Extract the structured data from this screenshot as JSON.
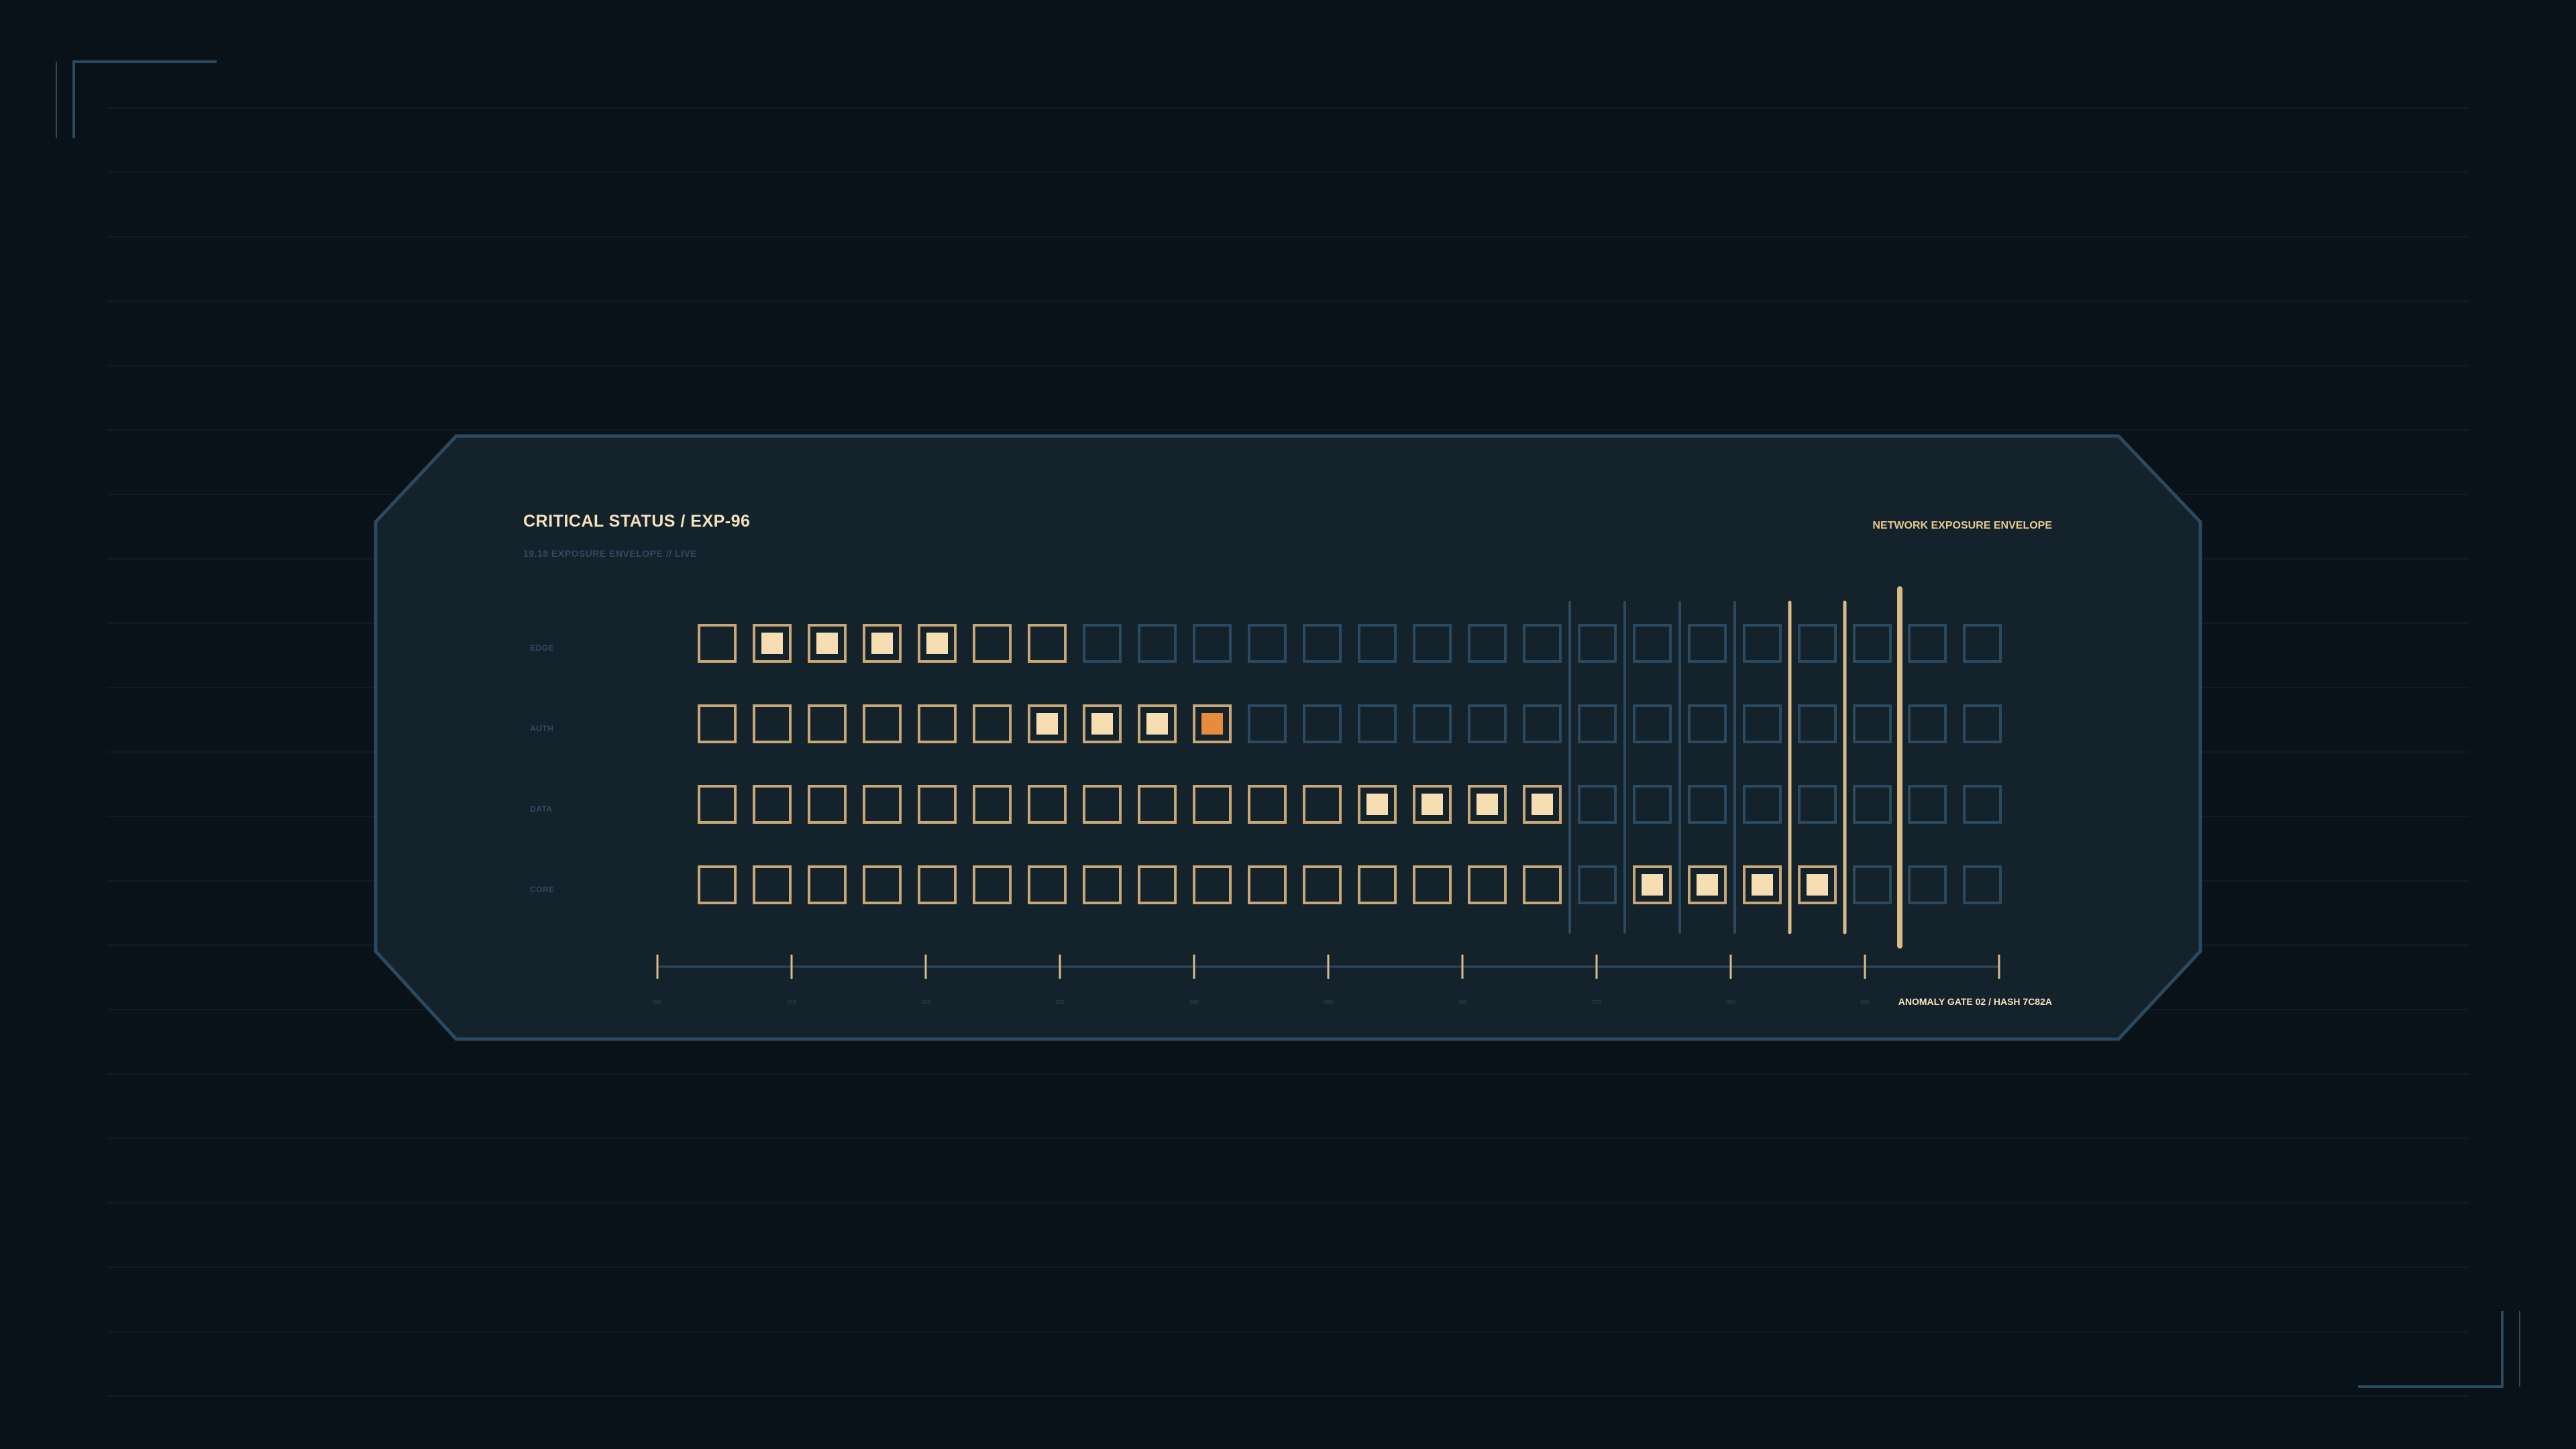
{
  "header": {
    "title": "CRITICAL STATUS / EXP-96",
    "subtitle": "19.18  EXPOSURE ENVELOPE  // LIVE",
    "right_label": "NETWORK EXPOSURE ENVELOPE"
  },
  "footer": {
    "anomaly_label": "ANOMALY GATE 02 / HASH 7C82A"
  },
  "colors": {
    "background": "#0a1219",
    "panel": "#14222c",
    "panel_border": "#2b4a60",
    "cell_inactive": "#2b4a60",
    "cell_active_border": "#c7a776",
    "fill_cream": "#f6ddb2",
    "fill_orange": "#e78b3c",
    "marker_gold": "#d9bb87"
  },
  "grid": {
    "columns": 24,
    "border_active_columns": 16,
    "rows": [
      {
        "label": "EDGE",
        "fills": {
          "1": "cream",
          "2": "cream",
          "3": "cream",
          "4": "cream"
        },
        "border_active_until": 7
      },
      {
        "label": "AUTH",
        "fills": {
          "6": "cream",
          "7": "cream",
          "8": "cream",
          "9": "orange"
        },
        "border_active_until": 10
      },
      {
        "label": "DATA",
        "fills": {
          "12": "cream",
          "13": "cream",
          "14": "cream",
          "15": "cream"
        },
        "border_active_until": 16
      },
      {
        "label": "CORE",
        "fills": {
          "17": "cream",
          "18": "cream",
          "19": "cream",
          "20": "cream"
        },
        "border_active_until": 16
      }
    ]
  },
  "markers": [
    {
      "column_gap": 16,
      "style": "thin"
    },
    {
      "column_gap": 17,
      "style": "thin"
    },
    {
      "column_gap": 18,
      "style": "thin"
    },
    {
      "column_gap": 19,
      "style": "thin"
    },
    {
      "column_gap": 20,
      "style": "gold"
    },
    {
      "column_gap": 21,
      "style": "gold"
    },
    {
      "column_gap": 22,
      "style": "gold-bold"
    }
  ],
  "axis": {
    "tick_labels": [
      "000",
      "010",
      "020",
      "030",
      "040",
      "050",
      "060",
      "070",
      "080",
      "090",
      ""
    ]
  }
}
